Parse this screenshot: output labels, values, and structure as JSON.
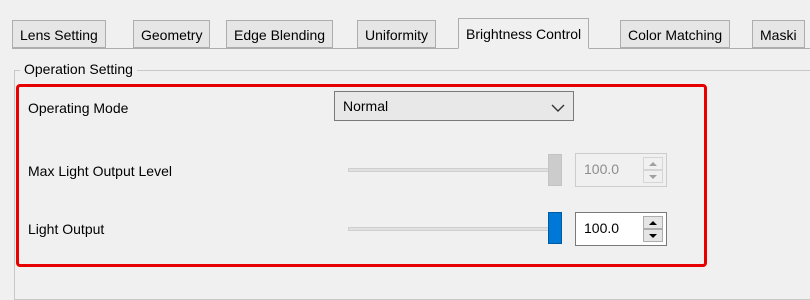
{
  "tabs": [
    {
      "label": "Lens Setting",
      "active": false
    },
    {
      "label": "Geometry",
      "active": false
    },
    {
      "label": "Edge Blending",
      "active": false
    },
    {
      "label": "Uniformity",
      "active": false
    },
    {
      "label": "Brightness Control",
      "active": true
    },
    {
      "label": "Color Matching",
      "active": false
    },
    {
      "label": "Maski",
      "active": false
    }
  ],
  "group": {
    "title": "Operation Setting"
  },
  "operating_mode": {
    "label": "Operating Mode",
    "value": "Normal",
    "icon": "chevron-down-icon"
  },
  "max_light_output": {
    "label": "Max Light Output Level",
    "value": "100.0",
    "slider_fraction": 1.0,
    "enabled": false
  },
  "light_output": {
    "label": "Light Output",
    "value": "100.0",
    "slider_fraction": 1.0,
    "enabled": true
  },
  "colors": {
    "highlight_border": "#e60000",
    "slider_thumb_active": "#0078d7",
    "slider_thumb_disabled": "#cccccc"
  }
}
